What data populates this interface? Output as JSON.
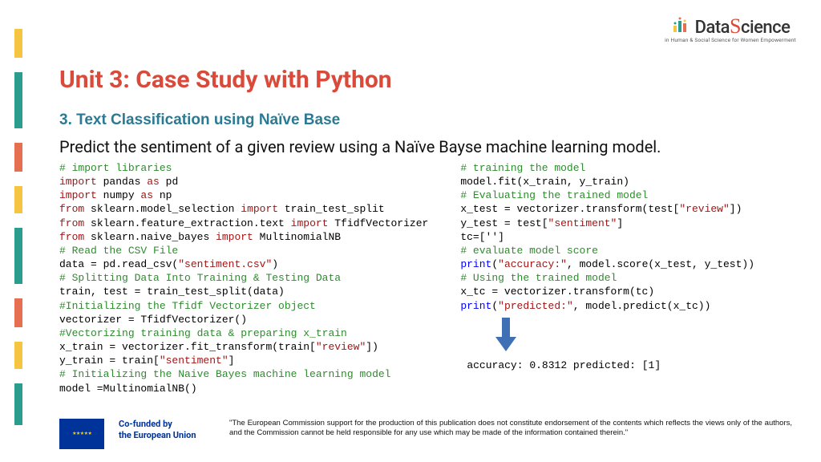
{
  "brand": {
    "name_left": "Data",
    "name_right": "cience",
    "tagline": "in Human & Social Science for Women Empowerment"
  },
  "unit_title": "Unit 3: Case Study with Python",
  "section_title": "3. Text Classification using Naïve Base",
  "description": "Predict the sentiment of a given review using a Naïve Bayse machine learning model.",
  "code_left": {
    "c1": "# import libraries",
    "l2a": "import",
    "l2b": " pandas ",
    "l2c": "as",
    "l2d": " pd",
    "l3a": "import",
    "l3b": " numpy ",
    "l3c": "as",
    "l3d": " np",
    "l4a": "from",
    "l4b": " sklearn.model_selection ",
    "l4c": "import",
    "l4d": " train_test_split",
    "l5a": "from",
    "l5b": " sklearn.feature_extraction.text ",
    "l5c": "import",
    "l5d": " TfidfVectorizer",
    "l6a": "from",
    "l6b": " sklearn.naive_bayes ",
    "l6c": "import",
    "l6d": " MultinomialNB",
    "c7": "# Read the CSV File",
    "l8a": "data = pd.read_csv(",
    "l8b": "\"sentiment.csv\"",
    "l8c": ")",
    "c9": "# Splitting Data Into Training & Testing Data",
    "l10": "train, test = train_test_split(data)",
    "c11": "#Initializing the Tfidf Vectorizer object",
    "l12": "vectorizer = TfidfVectorizer()",
    "c13": "#Vectorizing training data & preparing x_train",
    "l14a": "x_train = vectorizer.fit_transform(train[",
    "l14b": "\"review\"",
    "l14c": "])",
    "l15a": "y_train = train[",
    "l15b": "\"sentiment\"",
    "l15c": "]",
    "c16": "# Initializing the Naive Bayes machine learning model",
    "l17": "model =MultinomialNB()"
  },
  "code_right": {
    "c1": "# training the model",
    "l2": "model.fit(x_train, y_train)",
    "c3": "# Evaluating the trained model",
    "l4a": "x_test = vectorizer.transform(test[",
    "l4b": "\"review\"",
    "l4c": "])",
    "l5a": "y_test = test[",
    "l5b": "\"sentiment\"",
    "l5c": "]",
    "l6": "tc=['']",
    "c7": "# evaluate model score",
    "l8a": "print",
    "l8b": "(",
    "l8c": "\"accuracy:\"",
    "l8d": ", model.score(x_test, y_test))",
    "c9": "# Using the trained model",
    "l10": "x_tc = vectorizer.transform(tc)",
    "l11a": "print",
    "l11b": "(",
    "l11c": "\"predicted:\"",
    "l11d": ", model.predict(x_tc))"
  },
  "output": "accuracy: 0.8312 predicted: [1]",
  "footer": {
    "cofunded_l1": "Co-funded by",
    "cofunded_l2": "the European Union",
    "disclaimer": "\"The European Commission support for the production of this publication does not constitute endorsement of the contents which reflects the views only of the authors, and the Commission cannot be held responsible for any use which may be made of the information contained therein.\""
  }
}
